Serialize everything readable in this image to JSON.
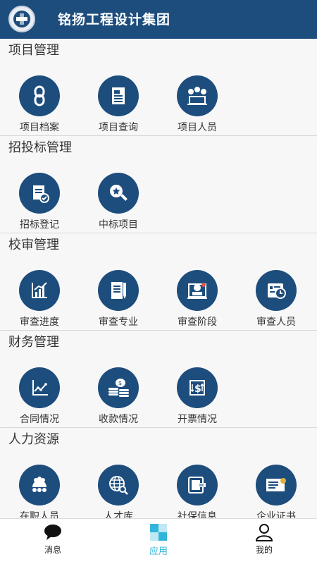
{
  "header": {
    "title": "铭扬工程设计集团",
    "logo_icon": "company-logo-icon"
  },
  "sections": [
    {
      "title": "项目管理",
      "items": [
        {
          "label": "项目档案",
          "icon": "link-icon"
        },
        {
          "label": "项目查询",
          "icon": "document-icon"
        },
        {
          "label": "项目人员",
          "icon": "people-icon"
        }
      ]
    },
    {
      "title": "招投标管理",
      "items": [
        {
          "label": "招标登记",
          "icon": "register-icon"
        },
        {
          "label": "中标项目",
          "icon": "magnifier-star-icon"
        }
      ]
    },
    {
      "title": "校审管理",
      "items": [
        {
          "label": "审查进度",
          "icon": "bar-chart-icon"
        },
        {
          "label": "审查专业",
          "icon": "edit-document-icon"
        },
        {
          "label": "审查阶段",
          "icon": "stage-icon"
        },
        {
          "label": "审查人员",
          "icon": "id-card-clock-icon"
        }
      ]
    },
    {
      "title": "财务管理",
      "items": [
        {
          "label": "合同情况",
          "icon": "line-chart-icon"
        },
        {
          "label": "收款情况",
          "icon": "coins-icon"
        },
        {
          "label": "开票情况",
          "icon": "dollar-box-icon"
        }
      ]
    },
    {
      "title": "人力资源",
      "items": [
        {
          "label": "在职人员",
          "icon": "group-icon"
        },
        {
          "label": "人才库",
          "icon": "globe-search-icon"
        },
        {
          "label": "社保信息",
          "icon": "device-icon"
        },
        {
          "label": "企业证书",
          "icon": "certificate-icon"
        }
      ]
    }
  ],
  "tabbar": {
    "tabs": [
      {
        "label": "消息",
        "icon": "chat-bubble-icon"
      },
      {
        "label": "应用",
        "icon": "apps-icon"
      },
      {
        "label": "我的",
        "icon": "user-icon"
      }
    ]
  },
  "colors": {
    "brand": "#1d4d7d",
    "accent": "#33b5d9",
    "background": "#f7f7f7"
  }
}
